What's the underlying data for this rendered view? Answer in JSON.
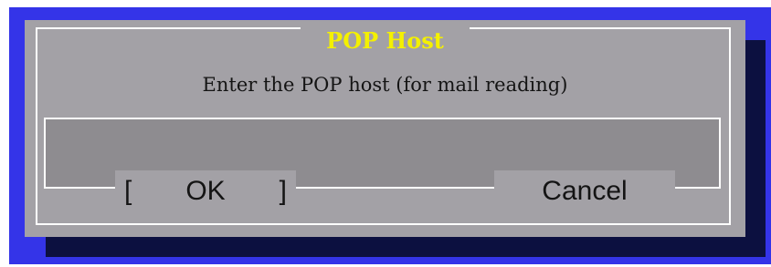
{
  "dialog": {
    "title": "POP Host",
    "prompt": "Enter the POP host (for mail reading)",
    "input_value": "",
    "ok_bracket_left": "[",
    "ok_label": "OK",
    "ok_bracket_right": "]",
    "cancel_label": "Cancel"
  },
  "colors": {
    "screen_background": "#3434e8",
    "dialog_background": "#a3a1a6",
    "dialog_shadow": "#0c1040",
    "title_text": "#f4f000",
    "input_background": "#8e8c90",
    "frame_lines": "#ffffff"
  }
}
